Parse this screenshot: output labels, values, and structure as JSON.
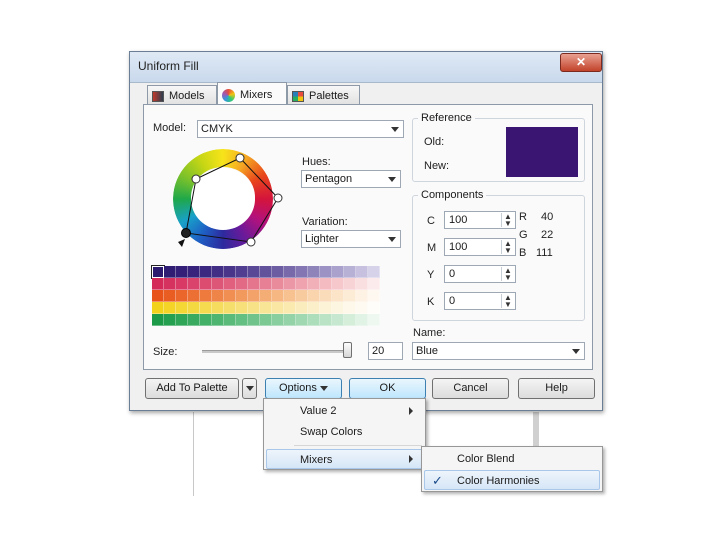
{
  "dialog": {
    "title": "Uniform Fill",
    "close_glyph": "✕",
    "tabs": [
      {
        "label": "Models",
        "icon": "models-icon"
      },
      {
        "label": "Mixers",
        "icon": "mixers-icon"
      },
      {
        "label": "Palettes",
        "icon": "palettes-icon"
      }
    ],
    "active_tab": "Mixers"
  },
  "mixer": {
    "model_label": "Model:",
    "model_value": "CMYK",
    "hues_label": "Hues:",
    "hues_value": "Pentagon",
    "variation_label": "Variation:",
    "variation_value": "Lighter",
    "size_label": "Size:",
    "size_value": "20",
    "swatch_rows": [
      [
        "#2b1a6e",
        "#2f1c73",
        "#331f78",
        "#37237c",
        "#3c2880",
        "#422e85",
        "#49358a",
        "#513e90",
        "#594896",
        "#62529c",
        "#6c5da3",
        "#7769aa",
        "#8376b2",
        "#8f84ba",
        "#9c92c3",
        "#aaa1cc",
        "#b8b1d6",
        "#c7c1df",
        "#d6d2e9"
      ],
      [
        "#d42a5a",
        "#d6325f",
        "#d83a65",
        "#da436b",
        "#dc4c71",
        "#de5677",
        "#e0607e",
        "#e26a85",
        "#e5758c",
        "#e78094",
        "#ea8b9c",
        "#ec97a5",
        "#efa3ae",
        "#f1afb7",
        "#f4bbc1",
        "#f6c7cb",
        "#f8d3d6",
        "#fadfe1",
        "#fcebec"
      ],
      [
        "#e8531a",
        "#e95c22",
        "#eb662b",
        "#ec7034",
        "#ee7a3e",
        "#ef8448",
        "#f18f53",
        "#f2995e",
        "#f3a36a",
        "#f5ad76",
        "#f6b783",
        "#f7c190",
        "#f8cb9e",
        "#f9d4ac",
        "#fadcba",
        "#fbe4c8",
        "#fcecd6",
        "#fdf2e3",
        "#fef8f0"
      ],
      [
        "#f2d21a",
        "#f3d427",
        "#f4d634",
        "#f4d842",
        "#f5da50",
        "#f6dc5e",
        "#f6de6c",
        "#f7e07a",
        "#f8e288",
        "#f8e596",
        "#f9e7a3",
        "#faeab0",
        "#faecbd",
        "#fbefc9",
        "#fcf2d5",
        "#fcf5e0",
        "#fdf8ea",
        "#fefaf2",
        "#fefdf9"
      ],
      [
        "#1c9a48",
        "#25a050",
        "#2fa558",
        "#39aa60",
        "#43b068",
        "#4eb570",
        "#59ba79",
        "#64bf82",
        "#70c48b",
        "#7cc994",
        "#88ce9e",
        "#94d3a8",
        "#a0d8b2",
        "#addebc",
        "#bae3c6",
        "#c7e8d0",
        "#d4eeda",
        "#e1f3e5",
        "#eef8f0"
      ]
    ]
  },
  "reference": {
    "title": "Reference",
    "old_label": "Old:",
    "new_label": "New:",
    "color": "#3a1572"
  },
  "components": {
    "title": "Components",
    "c_label": "C",
    "c_value": "100",
    "m_label": "M",
    "m_value": "100",
    "y_label": "Y",
    "y_value": "0",
    "k_label": "K",
    "k_value": "0",
    "r_label": "R",
    "r_value": "40",
    "g_label": "G",
    "g_value": "22",
    "b_label": "B",
    "b_value": "111"
  },
  "name": {
    "label": "Name:",
    "value": "Blue"
  },
  "buttons": {
    "add_to_palette": "Add To Palette",
    "options": "Options",
    "ok": "OK",
    "cancel": "Cancel",
    "help": "Help"
  },
  "options_menu": {
    "items": [
      "Value 2",
      "Swap Colors",
      "Mixers"
    ]
  },
  "mixers_submenu": {
    "items": [
      "Color Blend",
      "Color Harmonies"
    ],
    "checked": "Color Harmonies",
    "check_glyph": "✓"
  }
}
